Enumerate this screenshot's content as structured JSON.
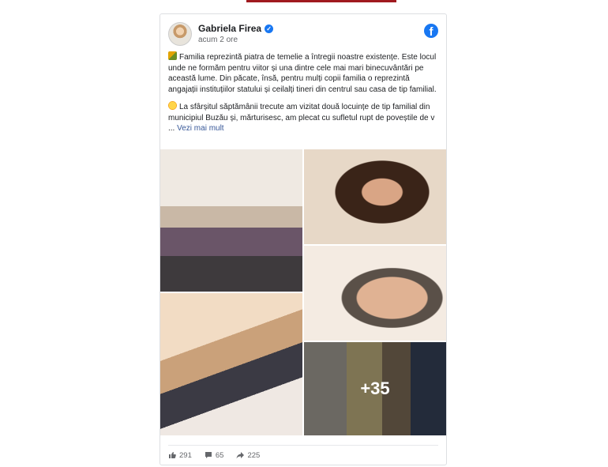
{
  "post": {
    "author": "Gabriela Firea",
    "time": "acum 2 ore",
    "paragraph1": "Familia reprezintă piatra de temelie a întregii noastre existențe. Este locul unde ne formăm pentru viitor și una dintre cele mai mari binecuvântări pe această lume. Din păcate, însă, pentru mulți copii familia o reprezintă angajații instituțiilor statului și ceilalți tineri din centrul sau casa de tip familial.",
    "paragraph2": "La sfârșitul săptămânii trecute am vizitat două locuințe de tip familial din municipiul Buzău și, mărturisesc, am plecat cu sufletul rupt de poveștile de v",
    "ellipsis": "...",
    "see_more": "Vezi mai mult",
    "more_photos": "+35"
  },
  "stats": {
    "likes": "291",
    "comments": "65",
    "shares": "225"
  },
  "icons": {
    "brand": "facebook-icon",
    "verified": "verified-badge-icon",
    "like": "thumbs-up-icon",
    "comment": "comment-icon",
    "share": "share-icon"
  },
  "colors": {
    "facebook_blue": "#1877f2",
    "link": "#385898",
    "muted": "#65676b",
    "top_accent": "#a01a1f"
  }
}
